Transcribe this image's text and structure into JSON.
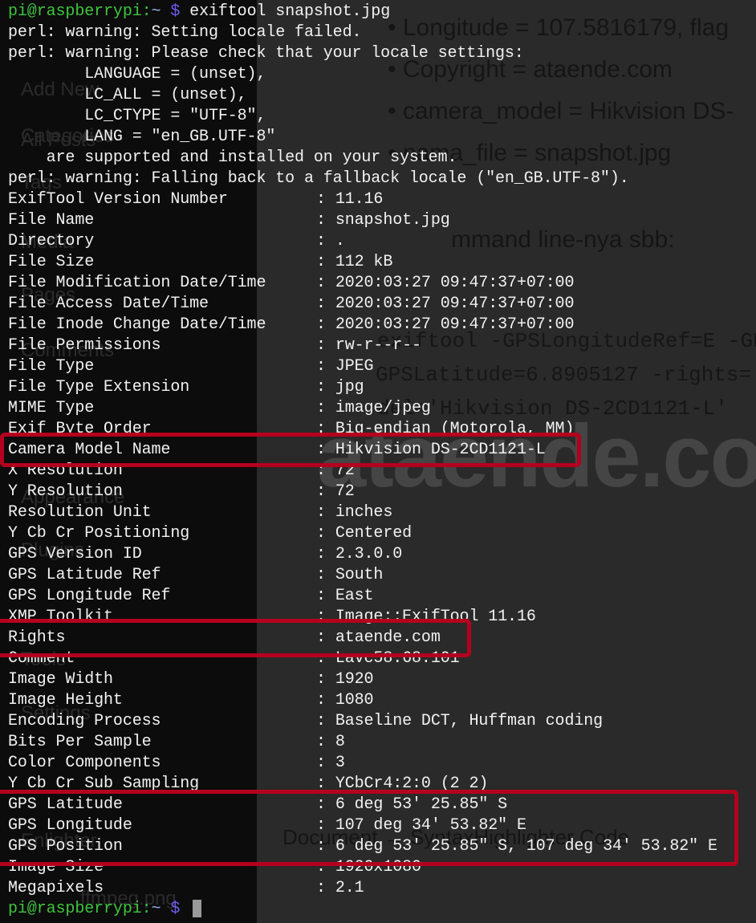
{
  "background": {
    "sidebar_items": [
      "All Posts",
      "Add New",
      "Categories",
      "Tags",
      "Media",
      "Pages",
      "Comments",
      "Appearance",
      "Plugins",
      "Tools",
      "Settings",
      "Enlighter"
    ],
    "content_lines": [
      "• Longitude = 107.5816179, flag",
      "• Copyright = ataende.com",
      "• camera_model = Hikvision DS-",
      "• nama_file = snapshot.jpg",
      "mmand line-nya sbb:"
    ],
    "code_lines": [
      "exiftool -GPSLongitudeRef=E -GP",
      "GPSLatitude=6.8905127 -rights=",
      "del='Hikvision DS-2CD1121-L'"
    ],
    "breadcrumb": "Document → SyntaxHighlighter Code",
    "file_item": "ffmpeg.png",
    "watermark": "ataende.com"
  },
  "terminal": {
    "prompt": {
      "user_host": "pi@raspberrypi",
      "colon": ":",
      "path": "~",
      "symbol": "$"
    },
    "command": "exiftool snapshot.jpg",
    "warnings": [
      "perl: warning: Setting locale failed.",
      "perl: warning: Please check that your locale settings:",
      "        LANGUAGE = (unset),",
      "        LC_ALL = (unset),",
      "        LC_CTYPE = \"UTF-8\",",
      "        LANG = \"en_GB.UTF-8\"",
      "    are supported and installed on your system.",
      "perl: warning: Falling back to a fallback locale (\"en_GB.UTF-8\")."
    ],
    "fields": [
      [
        "ExifTool Version Number",
        "11.16"
      ],
      [
        "File Name",
        "snapshot.jpg"
      ],
      [
        "Directory",
        "."
      ],
      [
        "File Size",
        "112 kB"
      ],
      [
        "File Modification Date/Time",
        "2020:03:27 09:47:37+07:00"
      ],
      [
        "File Access Date/Time",
        "2020:03:27 09:47:37+07:00"
      ],
      [
        "File Inode Change Date/Time",
        "2020:03:27 09:47:37+07:00"
      ],
      [
        "File Permissions",
        "rw-r--r--"
      ],
      [
        "File Type",
        "JPEG"
      ],
      [
        "File Type Extension",
        "jpg"
      ],
      [
        "MIME Type",
        "image/jpeg"
      ],
      [
        "Exif Byte Order",
        "Big-endian (Motorola, MM)"
      ],
      [
        "Camera Model Name",
        "Hikvision DS-2CD1121-L"
      ],
      [
        "X Resolution",
        "72"
      ],
      [
        "Y Resolution",
        "72"
      ],
      [
        "Resolution Unit",
        "inches"
      ],
      [
        "Y Cb Cr Positioning",
        "Centered"
      ],
      [
        "GPS Version ID",
        "2.3.0.0"
      ],
      [
        "GPS Latitude Ref",
        "South"
      ],
      [
        "GPS Longitude Ref",
        "East"
      ],
      [
        "XMP Toolkit",
        "Image::ExifTool 11.16"
      ],
      [
        "Rights",
        "ataende.com"
      ],
      [
        "Comment",
        "Lavc58.68.101"
      ],
      [
        "Image Width",
        "1920"
      ],
      [
        "Image Height",
        "1080"
      ],
      [
        "Encoding Process",
        "Baseline DCT, Huffman coding"
      ],
      [
        "Bits Per Sample",
        "8"
      ],
      [
        "Color Components",
        "3"
      ],
      [
        "Y Cb Cr Sub Sampling",
        "YCbCr4:2:0 (2 2)"
      ],
      [
        "GPS Latitude",
        "6 deg 53' 25.85\" S"
      ],
      [
        "GPS Longitude",
        "107 deg 34' 53.82\" E"
      ],
      [
        "GPS Position",
        "6 deg 53' 25.85\" S, 107 deg 34' 53.82\" E"
      ],
      [
        "Image Size",
        "1920x1080"
      ],
      [
        "Megapixels",
        "2.1"
      ]
    ]
  },
  "highlight_color": "#b4001e"
}
